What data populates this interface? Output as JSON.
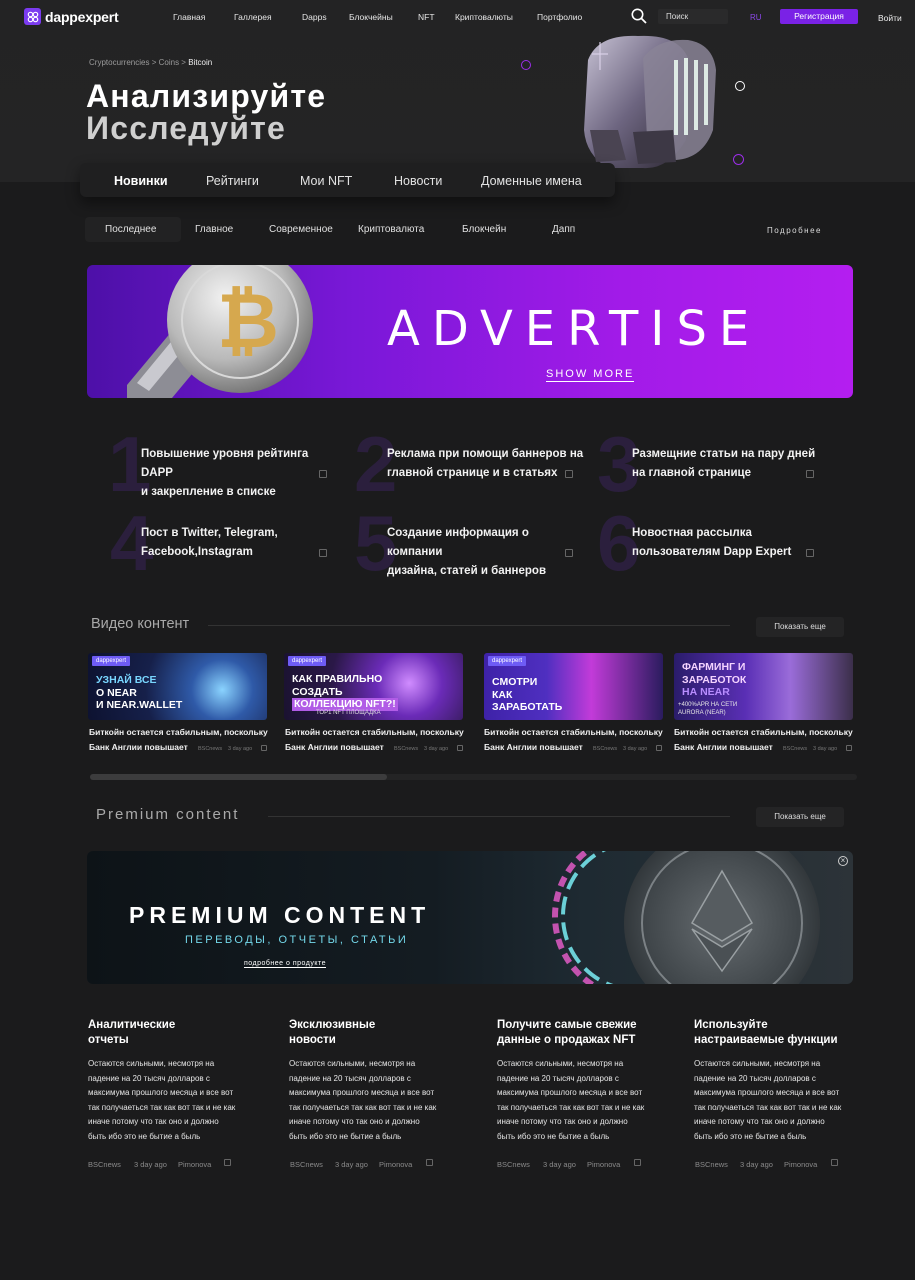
{
  "header": {
    "logo_text": "dappexpert",
    "nav": [
      "Главная",
      "Галлерея",
      "Dapps",
      "Блокчейны",
      "NFT",
      "Криптовалюты",
      "Портфолио"
    ],
    "search_placeholder": "Поиск",
    "lang": "RU",
    "register_label": "Регистрация",
    "login_label": "Войти"
  },
  "breadcrumb": {
    "part1": "Cryptocurrencies",
    "sep": ">",
    "part2": "Coins",
    "current": "Bitcoin"
  },
  "hero": {
    "line1": "Анализируйте",
    "line2": "Исследуйте"
  },
  "main_tabs": [
    "Новинки",
    "Рейтинги",
    "Мои NFT",
    "Новости",
    "Доменные имена"
  ],
  "sub_tabs": [
    "Последнее",
    "Главное",
    "Современное",
    "Криптовалюта",
    "Блокчейн",
    "Дапп"
  ],
  "sub_more": "Подробнее",
  "ad": {
    "title": "ADVERTISE",
    "more": "SHOW MORE"
  },
  "services": [
    {
      "num": "1",
      "l1": "Повышение уровня рейтинга DAPP",
      "l2": "и закрепление в списке"
    },
    {
      "num": "2",
      "l1": "Реклама при помощи баннеров на",
      "l2": "главной странице и в статьях"
    },
    {
      "num": "3",
      "l1": "Размещние статьи на пару дней",
      "l2": "на главной странице"
    },
    {
      "num": "4",
      "l1": "Пост в Twitter, Telegram,",
      "l2": "Facebook,Instagram"
    },
    {
      "num": "5",
      "l1": "Создание информация о компании",
      "l2": "дизайна, статей и баннеров"
    },
    {
      "num": "6",
      "l1": "Новостная рассылка",
      "l2": "пользователям Dapp Expert"
    }
  ],
  "video": {
    "title": "Видео контент",
    "show_more": "Показать еще",
    "cards": [
      {
        "tag": "dappexpert",
        "h1": "УЗНАЙ ВСЕ",
        "h2": "О NEAR",
        "h3": "И NEAR.WALLET",
        "foot": "",
        "cap1": "Биткойн остается стабильным, поскольку",
        "cap2": "Банк Англии повышает",
        "src": "BSCnews",
        "time": "3 day ago"
      },
      {
        "tag": "dappexpert",
        "h1": "КАК ПРАВИЛЬНО",
        "h2": "СОЗДАТЬ",
        "h3": "КОЛЛЕКЦИЮ NFT?!",
        "foot": "ТОР1 NFT ПЛОЩАДКА",
        "cap1": "Биткойн остается стабильным, поскольку",
        "cap2": "Банк Англии повышает",
        "src": "BSCnews",
        "time": "3 day ago"
      },
      {
        "tag": "dappexpert",
        "h1": "СМОТРИ",
        "h2": "КАК",
        "h3": "ЗАРАБОТАТЬ",
        "foot": "",
        "cap1": "Биткойн остается стабильным, поскольку",
        "cap2": "Банк Англии повышает",
        "src": "BSCnews",
        "time": "3 day ago"
      },
      {
        "tag": "",
        "h1": "ФАРМИНГ И",
        "h2": "ЗАРАБОТОК",
        "h3": "НА NEAR",
        "foot": "+400%APR НА СЕТИ AURORA (NEAR)",
        "cap1": "Биткойн остается стабильным, поскольку",
        "cap2": "Банк Англии повышает",
        "src": "BSCnews",
        "time": "3 day ago"
      }
    ],
    "scroll_position": 0.39
  },
  "premium": {
    "title": "Premium content",
    "show_more": "Показать еще",
    "banner_title": "PREMIUM CONTENT",
    "banner_sub": "ПЕРЕВОДЫ, ОТЧЕТЫ, СТАТЬИ",
    "banner_more": "подробнее о продукте"
  },
  "features": [
    {
      "t1": "Аналитические",
      "t2": "отчеты"
    },
    {
      "t1": "Эксклюзивные",
      "t2": "новости"
    },
    {
      "t1": "Получите самые свежие",
      "t2": "данные о продажах NFT"
    },
    {
      "t1": "Используйте",
      "t2": "настраиваемые функции"
    }
  ],
  "feature_body": [
    "Остаются сильными, несмотря на",
    "падение на 20 тысяч долларов с",
    "максимума прошлого месяца и все вот",
    "так получаеться так как вот так и не как",
    "иначе потому что так оно и должно",
    "быть ибо это не бытие а быль"
  ],
  "feature_meta": {
    "src": "BSCnews",
    "time": "3 day ago",
    "author": "Pimonova"
  },
  "colors": {
    "accent": "#7a22e6",
    "bg": "#1b1b1c",
    "premium_sub": "#74d8ea"
  }
}
